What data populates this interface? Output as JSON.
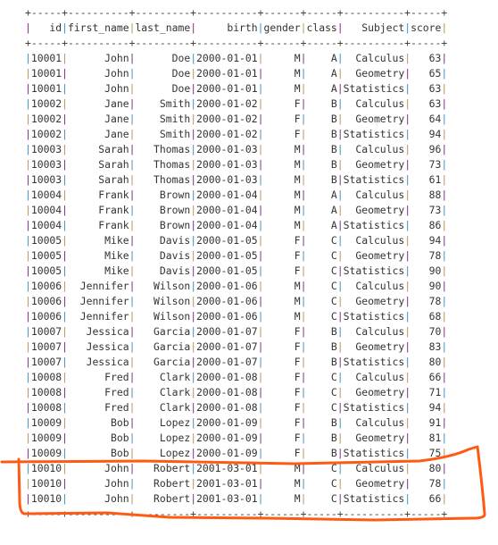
{
  "table": {
    "columns": [
      {
        "name": "id",
        "width": 5,
        "align": "right"
      },
      {
        "name": "first_name",
        "width": 10,
        "align": "right"
      },
      {
        "name": "last_name",
        "width": 9,
        "align": "right"
      },
      {
        "name": "birth",
        "width": 10,
        "align": "right"
      },
      {
        "name": "gender",
        "width": 6,
        "align": "right"
      },
      {
        "name": "class",
        "width": 5,
        "align": "right"
      },
      {
        "name": "Subject",
        "width": 10,
        "align": "right"
      },
      {
        "name": "score",
        "width": 5,
        "align": "right"
      }
    ],
    "rows": [
      [
        "10001",
        "John",
        "Doe",
        "2000-01-01",
        "M",
        "A",
        "Calculus",
        "63"
      ],
      [
        "10001",
        "John",
        "Doe",
        "2000-01-01",
        "M",
        "A",
        "Geometry",
        "65"
      ],
      [
        "10001",
        "John",
        "Doe",
        "2000-01-01",
        "M",
        "A",
        "Statistics",
        "63"
      ],
      [
        "10002",
        "Jane",
        "Smith",
        "2000-01-02",
        "F",
        "B",
        "Calculus",
        "63"
      ],
      [
        "10002",
        "Jane",
        "Smith",
        "2000-01-02",
        "F",
        "B",
        "Geometry",
        "64"
      ],
      [
        "10002",
        "Jane",
        "Smith",
        "2000-01-02",
        "F",
        "B",
        "Statistics",
        "94"
      ],
      [
        "10003",
        "Sarah",
        "Thomas",
        "2000-01-03",
        "M",
        "B",
        "Calculus",
        "96"
      ],
      [
        "10003",
        "Sarah",
        "Thomas",
        "2000-01-03",
        "M",
        "B",
        "Geometry",
        "73"
      ],
      [
        "10003",
        "Sarah",
        "Thomas",
        "2000-01-03",
        "M",
        "B",
        "Statistics",
        "61"
      ],
      [
        "10004",
        "Frank",
        "Brown",
        "2000-01-04",
        "M",
        "A",
        "Calculus",
        "88"
      ],
      [
        "10004",
        "Frank",
        "Brown",
        "2000-01-04",
        "M",
        "A",
        "Geometry",
        "73"
      ],
      [
        "10004",
        "Frank",
        "Brown",
        "2000-01-04",
        "M",
        "A",
        "Statistics",
        "86"
      ],
      [
        "10005",
        "Mike",
        "Davis",
        "2000-01-05",
        "F",
        "C",
        "Calculus",
        "94"
      ],
      [
        "10005",
        "Mike",
        "Davis",
        "2000-01-05",
        "F",
        "C",
        "Geometry",
        "78"
      ],
      [
        "10005",
        "Mike",
        "Davis",
        "2000-01-05",
        "F",
        "C",
        "Statistics",
        "90"
      ],
      [
        "10006",
        "Jennifer",
        "Wilson",
        "2000-01-06",
        "M",
        "C",
        "Calculus",
        "90"
      ],
      [
        "10006",
        "Jennifer",
        "Wilson",
        "2000-01-06",
        "M",
        "C",
        "Geometry",
        "78"
      ],
      [
        "10006",
        "Jennifer",
        "Wilson",
        "2000-01-06",
        "M",
        "C",
        "Statistics",
        "68"
      ],
      [
        "10007",
        "Jessica",
        "Garcia",
        "2000-01-07",
        "F",
        "B",
        "Calculus",
        "70"
      ],
      [
        "10007",
        "Jessica",
        "Garcia",
        "2000-01-07",
        "F",
        "B",
        "Geometry",
        "83"
      ],
      [
        "10007",
        "Jessica",
        "Garcia",
        "2000-01-07",
        "F",
        "B",
        "Statistics",
        "80"
      ],
      [
        "10008",
        "Fred",
        "Clark",
        "2000-01-08",
        "F",
        "C",
        "Calculus",
        "66"
      ],
      [
        "10008",
        "Fred",
        "Clark",
        "2000-01-08",
        "F",
        "C",
        "Geometry",
        "71"
      ],
      [
        "10008",
        "Fred",
        "Clark",
        "2000-01-08",
        "F",
        "C",
        "Statistics",
        "94"
      ],
      [
        "10009",
        "Bob",
        "Lopez",
        "2000-01-09",
        "F",
        "B",
        "Calculus",
        "91"
      ],
      [
        "10009",
        "Bob",
        "Lopez",
        "2000-01-09",
        "F",
        "B",
        "Geometry",
        "81"
      ],
      [
        "10009",
        "Bob",
        "Lopez",
        "2000-01-09",
        "F",
        "B",
        "Statistics",
        "75"
      ],
      [
        "10010",
        "John",
        "Robert",
        "2001-03-01",
        "M",
        "C",
        "Calculus",
        "80"
      ],
      [
        "10010",
        "John",
        "Robert",
        "2001-03-01",
        "M",
        "C",
        "Geometry",
        "78"
      ],
      [
        "10010",
        "John",
        "Robert",
        "2001-03-01",
        "M",
        "C",
        "Statistics",
        "66"
      ]
    ]
  },
  "annotation": {
    "type": "freehand-highlight",
    "color": "#ff5a14",
    "highlighted_ids": [
      "10010"
    ]
  }
}
